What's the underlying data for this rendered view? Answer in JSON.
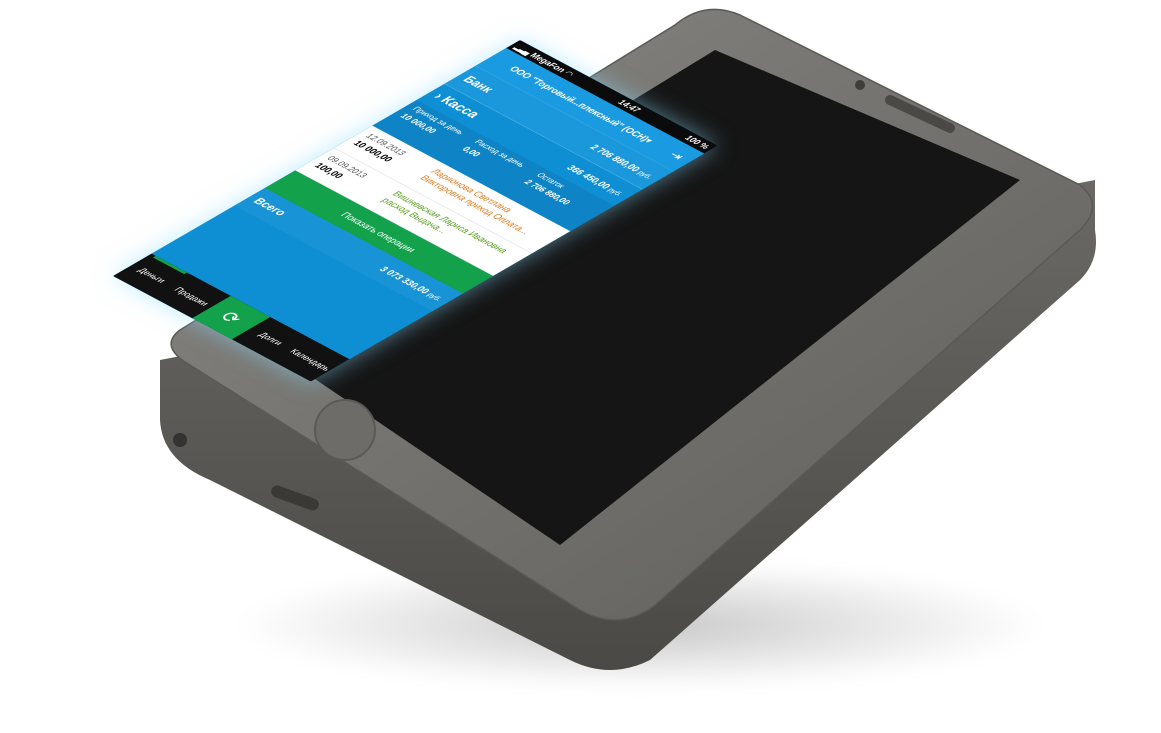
{
  "status_bar": {
    "carrier": "MegaFon",
    "time": "14:47",
    "battery": "100 %"
  },
  "header": {
    "organization": "ООО \"Торговый...плексный\" (ОСН)▾"
  },
  "bank": {
    "label": "Банк",
    "amount": "2 706 880,00",
    "currency": "руб."
  },
  "kassa": {
    "label": "Касса",
    "amount": "366 450,00",
    "currency": "руб."
  },
  "stats": {
    "income_label": "Приход за день",
    "income_value": "10 000,00",
    "expense_label": "Расход за день",
    "expense_value": "0,00",
    "balance_label": "Остаток",
    "balance_value": "2 706 880,00"
  },
  "operations": [
    {
      "date": "12.09.2013",
      "amount": "10 000,00",
      "description": "Ларионова Светлана Викторовна приход Оплата...",
      "color": "#e07b1d"
    },
    {
      "date": "09.09.2013",
      "amount": "100,00",
      "description": "Вишневская Лариса Ивановна расход Выдача...",
      "color": "#5a9e22"
    }
  ],
  "show_operations_label": "Показать операции",
  "total": {
    "label": "Всего",
    "amount": "3 073 330,00",
    "currency": "руб."
  },
  "tabs": [
    "Деньги",
    "Продажи",
    "Долги",
    "Календарь"
  ]
}
